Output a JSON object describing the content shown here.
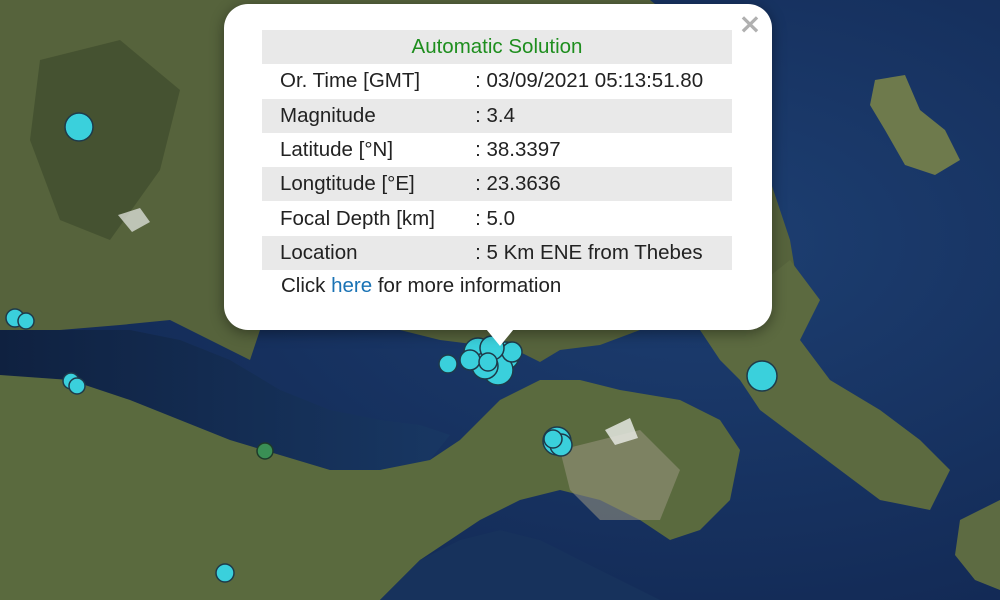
{
  "popup": {
    "title": "Automatic Solution",
    "rows": [
      {
        "label": "Or. Time [GMT]",
        "value": ": 03/09/2021 05:13:51.80"
      },
      {
        "label": "Magnitude",
        "value": ": 3.4"
      },
      {
        "label": "Latitude [°N]",
        "value": ": 38.3397"
      },
      {
        "label": "Longtitude [°E]",
        "value": ": 23.3636"
      },
      {
        "label": "Focal Depth [km]",
        "value": ": 5.0"
      },
      {
        "label": "Location",
        "value": ": 5 Km ENE from Thebes"
      }
    ],
    "more_prefix": "Click",
    "more_link": "here",
    "more_suffix": "for more information",
    "close_label": "×"
  },
  "colors": {
    "marker_fill": "#3ad0dc",
    "marker_green": "#3a8f55",
    "title_green": "#1e8e1e",
    "link_blue": "#1a73b5",
    "sea": "#16305a",
    "land": "#4f5f3a"
  }
}
